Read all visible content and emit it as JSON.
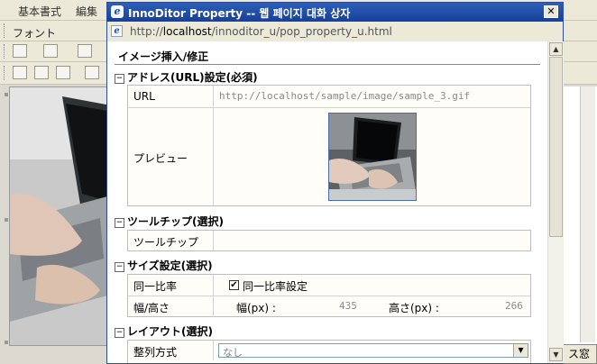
{
  "background": {
    "menubar_items": [
      "基本書式",
      "編集"
    ],
    "font_label": "フォント",
    "corner_button": "ス窓"
  },
  "dialog": {
    "title": "InnoDitor Property -- 웹 페이지 대화 상자",
    "close_glyph": "✕",
    "address": {
      "prefix": "http://",
      "host": "localhost",
      "path": "/innoditor_u/pop_property_u.html"
    },
    "page_title": "イメージ挿入/修正",
    "sections": {
      "address": {
        "toggle": "⊟",
        "heading": "アドレス(URL)設定(必須)",
        "url_label": "URL",
        "url_value": "http://localhost/sample/image/sample_3.gif",
        "preview_label": "プレビュー"
      },
      "tooltip": {
        "toggle": "⊟",
        "heading": "ツールチップ(選択)",
        "tooltip_label": "ツールチップ",
        "tooltip_value": ""
      },
      "size": {
        "toggle": "⊟",
        "heading": "サイズ設定(選択)",
        "ratio_label": "同一比率",
        "ratio_checkbox_label": "同一比率設定",
        "ratio_checked": true,
        "check_glyph": "✔",
        "dims_label": "幅/高さ",
        "width_label": "幅(px) :",
        "width_value": "435",
        "height_label": "高さ(px) :",
        "height_value": "266"
      },
      "layout": {
        "toggle": "⊟",
        "heading": "レイアウト(選択)",
        "align_label": "整列方式",
        "align_value": "なし"
      }
    }
  },
  "icons": {
    "ie": "ie-logo-icon",
    "close": "close-icon",
    "dropdown": "dropdown-arrow-icon",
    "scroll_up": "scroll-up-arrow-icon",
    "scroll_down": "scroll-down-arrow-icon"
  },
  "colors": {
    "titlebar": "#2e5fb8",
    "window_bg": "#ece9d8",
    "table_bg": "#fffdf8",
    "url_gray": "#8a8a8a"
  }
}
